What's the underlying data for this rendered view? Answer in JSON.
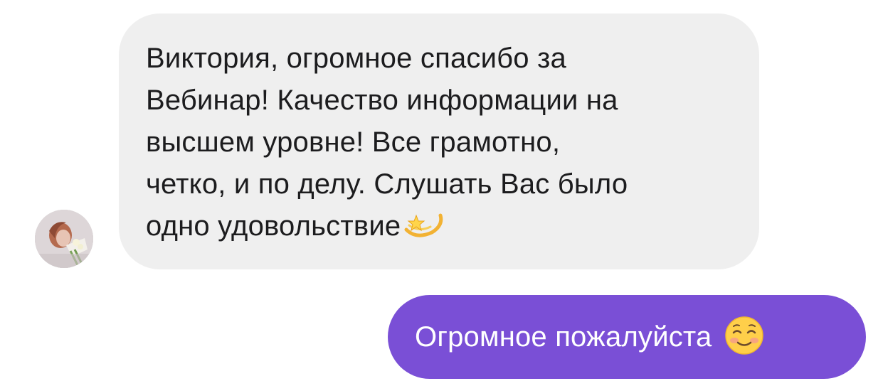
{
  "incoming_message": {
    "lines": [
      "Виктория, огромное спасибо за",
      "Вебинар! Качество информации на",
      "высшем уровне! Все грамотно,",
      "четко, и по делу. Слушать Вас было",
      "одно удовольствие"
    ],
    "emoji": "dizzy-star-icon"
  },
  "outgoing_message": {
    "text": "Огромное пожалуйста",
    "emoji": "smiling-face-icon"
  },
  "colors": {
    "incoming_bubble": "#efefef",
    "outgoing_bubble": "#7a4fd6",
    "incoming_text": "#1c1c1e",
    "outgoing_text": "#ffffff"
  }
}
